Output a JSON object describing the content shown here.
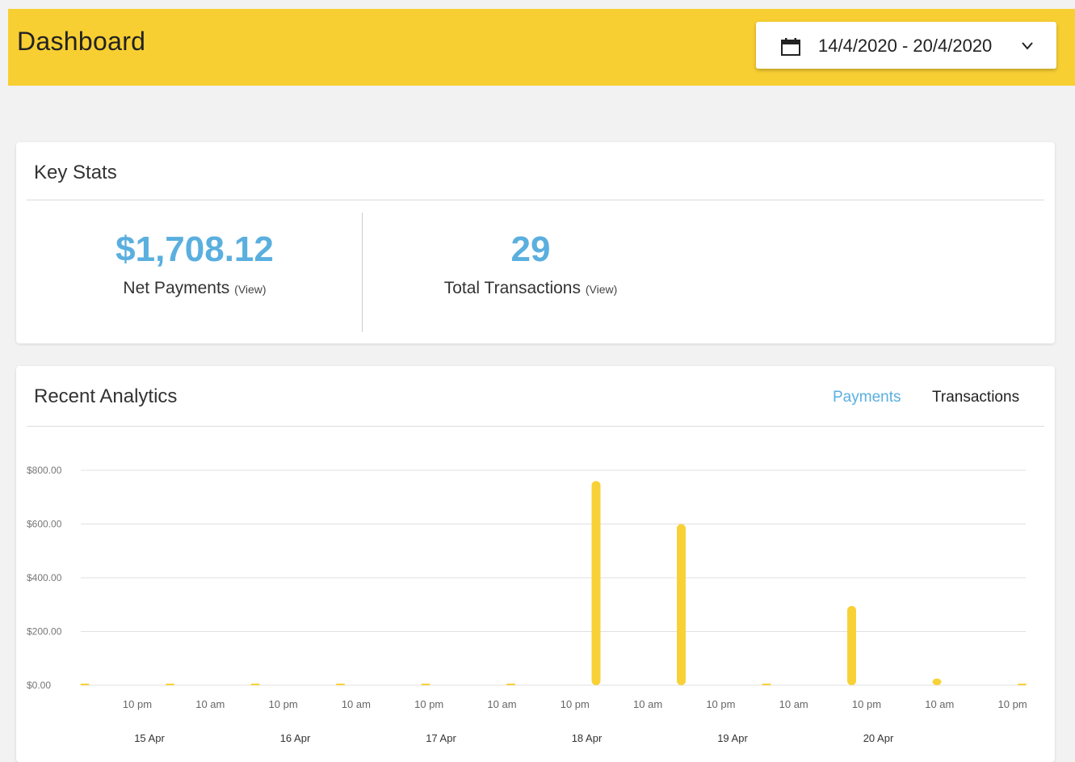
{
  "header": {
    "title": "Dashboard",
    "date_range": "14/4/2020 - 20/4/2020",
    "accent_color": "#f8cf32"
  },
  "key_stats": {
    "title": "Key Stats",
    "net_payments": {
      "value": "$1,708.12",
      "label": "Net Payments",
      "view_label": "(View)"
    },
    "total_transactions": {
      "value": "29",
      "label": "Total Transactions",
      "view_label": "(View)"
    },
    "value_color": "#5aafdf"
  },
  "analytics": {
    "title": "Recent Analytics",
    "tabs": [
      {
        "label": "Payments",
        "active": true
      },
      {
        "label": "Transactions",
        "active": false
      }
    ]
  },
  "chart_data": {
    "type": "bar",
    "y_tick_labels": [
      "$800.00",
      "$600.00",
      "$400.00",
      "$200.00",
      "$0.00"
    ],
    "ylim": [
      0,
      800
    ],
    "grid": true,
    "bar_color": "#f8d137",
    "x_time_labels": [
      "10 pm",
      "10 am",
      "10 pm",
      "10 am",
      "10 pm",
      "10 am",
      "10 pm",
      "10 am",
      "10 pm",
      "10 am",
      "10 pm",
      "10 am",
      "10 pm"
    ],
    "x_date_labels": [
      "15 Apr",
      "16 Apr",
      "17 Apr",
      "18 Apr",
      "19 Apr",
      "20 Apr"
    ],
    "series": [
      {
        "values": [
          0,
          0,
          0,
          0,
          0,
          0,
          760,
          600,
          0,
          295,
          25,
          0
        ]
      }
    ]
  }
}
